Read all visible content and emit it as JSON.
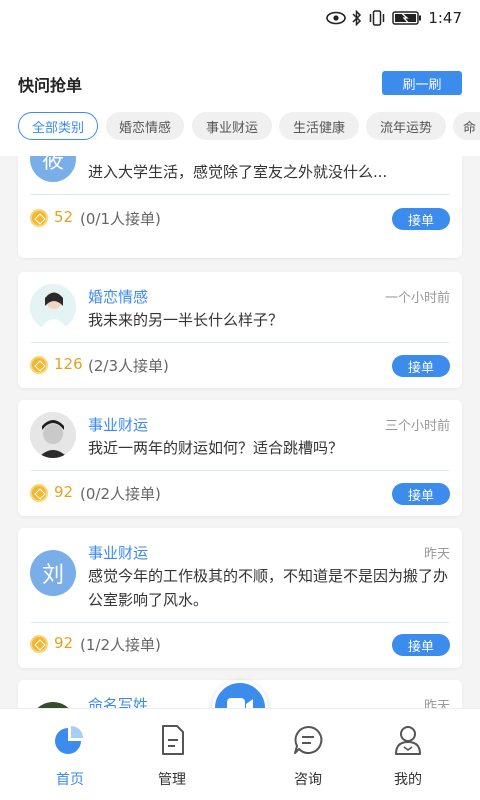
{
  "status_bar": {
    "time": "1:47"
  },
  "header": {
    "title": "快问抢单",
    "refresh_label": "刷一刷"
  },
  "categories": [
    "全部类别",
    "婚恋情感",
    "事业财运",
    "生活健康",
    "流年运势",
    "命"
  ],
  "active_category": "全部类别",
  "colors": {
    "accent": "#3b8ced",
    "coin": "#f3b630",
    "reward_text": "#e3a320"
  },
  "cards": [
    {
      "avatar_text": "筱",
      "question": "我现在人际关系怎么样？可以交到什么知己吗？因为刚进入大学生活，感觉除了室友之外就没什么...",
      "reward": "52",
      "takers": "(0/1人接单)",
      "button": "接单"
    },
    {
      "category": "婚恋情感",
      "time": "一个小时前",
      "question": "我未来的另一半长什么样子？",
      "reward": "126",
      "takers": "(2/3人接单)",
      "button": "接单"
    },
    {
      "category": "事业财运",
      "time": "三个小时前",
      "question": "我近一两年的财运如何？适合跳槽吗？",
      "reward": "92",
      "takers": "(0/2人接单)",
      "button": "接单"
    },
    {
      "avatar_text": "刘",
      "category": "事业财运",
      "time": "昨天",
      "question": "感觉今年的工作极其的不顺，不知道是不是因为搬了办公室影响了风水。",
      "reward": "92",
      "takers": "(1/2人接单)",
      "button": "接单"
    },
    {
      "category": "命名写姓",
      "time": "昨天"
    }
  ],
  "tabs": [
    {
      "label": "首页",
      "icon": "home-pie-icon",
      "active": true
    },
    {
      "label": "管理",
      "icon": "document-icon",
      "active": false
    },
    {
      "label": "咨询",
      "icon": "chat-bubble-icon",
      "active": false
    },
    {
      "label": "我的",
      "icon": "person-icon",
      "active": false
    }
  ],
  "center_button": {
    "icon": "video-camera-icon"
  }
}
